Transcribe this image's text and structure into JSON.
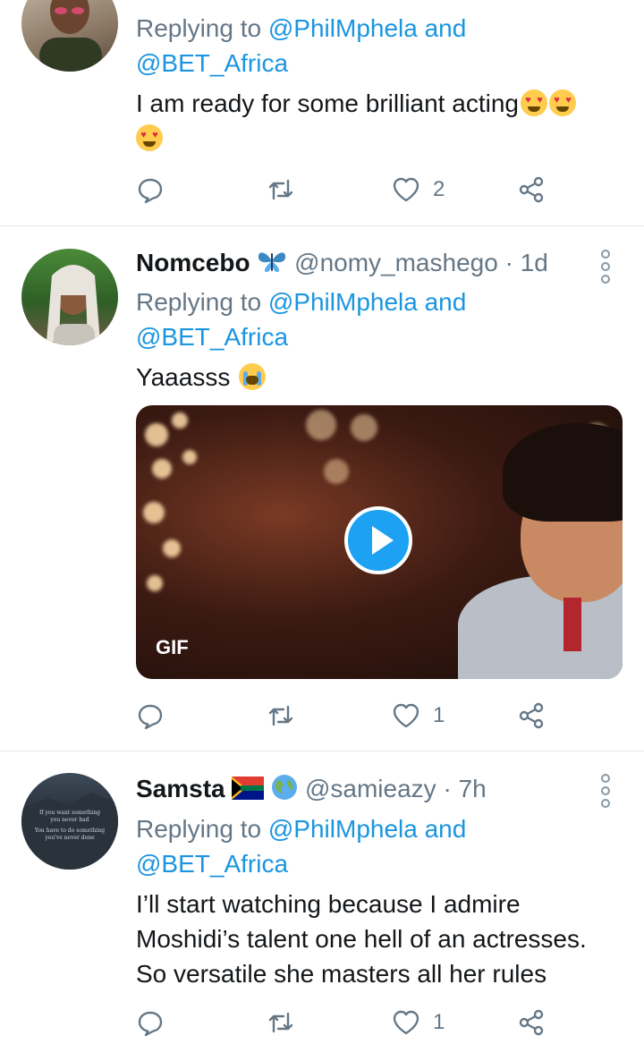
{
  "colors": {
    "link": "#1b95e0",
    "muted": "#657786",
    "divider": "#e1e8ed",
    "accent": "#1da1f2"
  },
  "tweets": [
    {
      "replying_prefix": "Replying to ",
      "reply_link_1": "@PhilMphela",
      "reply_and": " and",
      "reply_link_2": "@BET_Africa",
      "text": "I am ready for some brilliant acting",
      "emojis": [
        "heart-eyes-emoji",
        "heart-eyes-emoji",
        "heart-eyes-emoji"
      ],
      "reply_count": "",
      "retweet_count": "",
      "like_count": "2"
    },
    {
      "name": "Nomcebo",
      "name_emoji": "butterfly-emoji",
      "handle": "@nomy_mashego",
      "time": "· 1d",
      "replying_prefix": "Replying to ",
      "reply_link_1": "@PhilMphela",
      "reply_and": " and",
      "reply_link_2": "@BET_Africa",
      "text": "Yaaasss",
      "emojis": [
        "loudly-crying-emoji"
      ],
      "media_badge": "GIF",
      "reply_count": "",
      "retweet_count": "",
      "like_count": "1"
    },
    {
      "name": "Samsta",
      "name_emoji": "south-africa-flag-emoji",
      "name_emoji_2": "globe-emoji",
      "handle": "@samieazy",
      "time": "· 7h",
      "replying_prefix": "Replying to ",
      "reply_link_1": "@PhilMphela",
      "reply_and": " and",
      "reply_link_2": "@BET_Africa",
      "text_lines": [
        "I’ll start watching because I admire",
        "Moshidi’s talent one hell of an actresses.",
        "So versatile she masters all her rules"
      ],
      "avatar_text": [
        "If you want something",
        "you never had",
        "You have to do something",
        "you've never done"
      ],
      "reply_count": "",
      "retweet_count": "",
      "like_count": "1"
    }
  ]
}
